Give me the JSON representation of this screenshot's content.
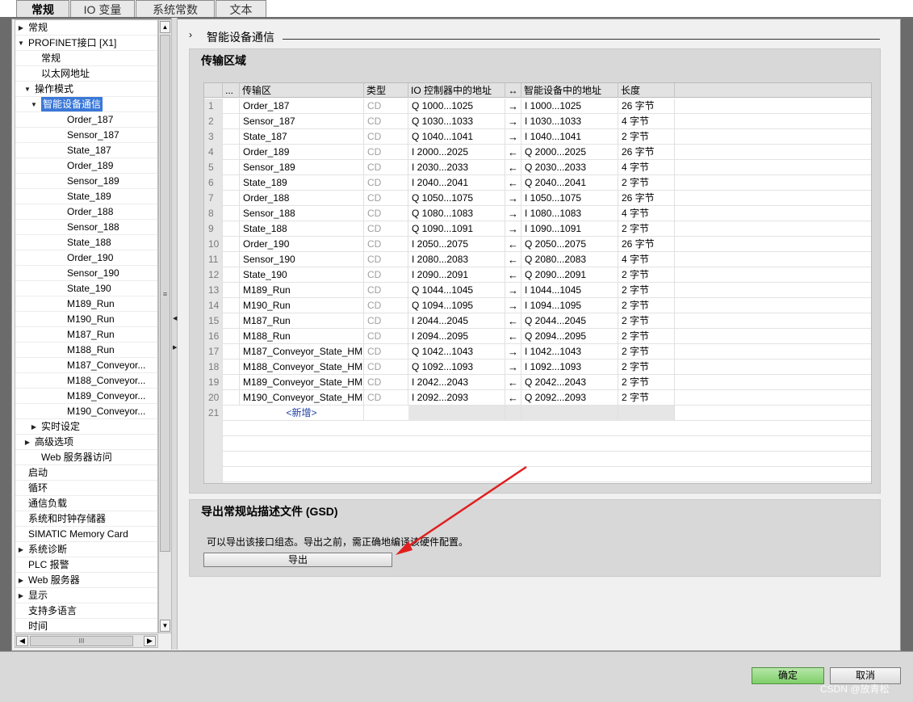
{
  "tabs": [
    "常规",
    "IO 变量",
    "系统常数",
    "文本"
  ],
  "tree": [
    {
      "label": "常规",
      "indent": 0,
      "arrow": "right"
    },
    {
      "label": "PROFINET接口 [X1]",
      "indent": 0,
      "arrow": "down"
    },
    {
      "label": "常规",
      "indent": 2,
      "arrow": ""
    },
    {
      "label": "以太网地址",
      "indent": 2,
      "arrow": ""
    },
    {
      "label": "操作模式",
      "indent": 1,
      "arrow": "down"
    },
    {
      "label": "智能设备通信",
      "indent": 2,
      "arrow": "down",
      "selected": true
    },
    {
      "label": "Order_187",
      "indent": 4,
      "arrow": ""
    },
    {
      "label": "Sensor_187",
      "indent": 4,
      "arrow": ""
    },
    {
      "label": "State_187",
      "indent": 4,
      "arrow": ""
    },
    {
      "label": "Order_189",
      "indent": 4,
      "arrow": ""
    },
    {
      "label": "Sensor_189",
      "indent": 4,
      "arrow": ""
    },
    {
      "label": "State_189",
      "indent": 4,
      "arrow": ""
    },
    {
      "label": "Order_188",
      "indent": 4,
      "arrow": ""
    },
    {
      "label": "Sensor_188",
      "indent": 4,
      "arrow": ""
    },
    {
      "label": "State_188",
      "indent": 4,
      "arrow": ""
    },
    {
      "label": "Order_190",
      "indent": 4,
      "arrow": ""
    },
    {
      "label": "Sensor_190",
      "indent": 4,
      "arrow": ""
    },
    {
      "label": "State_190",
      "indent": 4,
      "arrow": ""
    },
    {
      "label": "M189_Run",
      "indent": 4,
      "arrow": ""
    },
    {
      "label": "M190_Run",
      "indent": 4,
      "arrow": ""
    },
    {
      "label": "M187_Run",
      "indent": 4,
      "arrow": ""
    },
    {
      "label": "M188_Run",
      "indent": 4,
      "arrow": ""
    },
    {
      "label": "M187_Conveyor...",
      "indent": 4,
      "arrow": ""
    },
    {
      "label": "M188_Conveyor...",
      "indent": 4,
      "arrow": ""
    },
    {
      "label": "M189_Conveyor...",
      "indent": 4,
      "arrow": ""
    },
    {
      "label": "M190_Conveyor...",
      "indent": 4,
      "arrow": ""
    },
    {
      "label": "实时设定",
      "indent": 2,
      "arrow": "right"
    },
    {
      "label": "高级选项",
      "indent": 1,
      "arrow": "right"
    },
    {
      "label": "Web 服务器访问",
      "indent": 2,
      "arrow": ""
    },
    {
      "label": "启动",
      "indent": 0,
      "arrow": ""
    },
    {
      "label": "循环",
      "indent": 0,
      "arrow": ""
    },
    {
      "label": "通信负载",
      "indent": 0,
      "arrow": ""
    },
    {
      "label": "系统和时钟存储器",
      "indent": 0,
      "arrow": ""
    },
    {
      "label": "SIMATIC Memory Card",
      "indent": 0,
      "arrow": ""
    },
    {
      "label": "系统诊断",
      "indent": 0,
      "arrow": "right"
    },
    {
      "label": "PLC 报警",
      "indent": 0,
      "arrow": ""
    },
    {
      "label": "Web 服务器",
      "indent": 0,
      "arrow": "right"
    },
    {
      "label": "显示",
      "indent": 0,
      "arrow": "right"
    },
    {
      "label": "支持多语言",
      "indent": 0,
      "arrow": ""
    },
    {
      "label": "时间",
      "indent": 0,
      "arrow": ""
    }
  ],
  "section_title": "智能设备通信",
  "transfer_panel_title": "传输区域",
  "table_headers": [
    "...",
    "传输区",
    "类型",
    "IO 控制器中的地址",
    "↔",
    "智能设备中的地址",
    "长度"
  ],
  "table_rows": [
    {
      "num": "1",
      "name": "Order_187",
      "type": "CD",
      "io": "Q 1000...1025",
      "dir": "→",
      "dev": "I 1000...1025",
      "len": "26 字节"
    },
    {
      "num": "2",
      "name": "Sensor_187",
      "type": "CD",
      "io": "Q 1030...1033",
      "dir": "→",
      "dev": "I 1030...1033",
      "len": "4 字节"
    },
    {
      "num": "3",
      "name": "State_187",
      "type": "CD",
      "io": "Q 1040...1041",
      "dir": "→",
      "dev": "I 1040...1041",
      "len": "2 字节"
    },
    {
      "num": "4",
      "name": "Order_189",
      "type": "CD",
      "io": "I 2000...2025",
      "dir": "←",
      "dev": "Q 2000...2025",
      "len": "26 字节"
    },
    {
      "num": "5",
      "name": "Sensor_189",
      "type": "CD",
      "io": "I 2030...2033",
      "dir": "←",
      "dev": "Q 2030...2033",
      "len": "4 字节"
    },
    {
      "num": "6",
      "name": "State_189",
      "type": "CD",
      "io": "I 2040...2041",
      "dir": "←",
      "dev": "Q 2040...2041",
      "len": "2 字节"
    },
    {
      "num": "7",
      "name": "Order_188",
      "type": "CD",
      "io": "Q 1050...1075",
      "dir": "→",
      "dev": "I 1050...1075",
      "len": "26 字节"
    },
    {
      "num": "8",
      "name": "Sensor_188",
      "type": "CD",
      "io": "Q 1080...1083",
      "dir": "→",
      "dev": "I 1080...1083",
      "len": "4 字节"
    },
    {
      "num": "9",
      "name": "State_188",
      "type": "CD",
      "io": "Q 1090...1091",
      "dir": "→",
      "dev": "I 1090...1091",
      "len": "2 字节"
    },
    {
      "num": "10",
      "name": "Order_190",
      "type": "CD",
      "io": "I 2050...2075",
      "dir": "←",
      "dev": "Q 2050...2075",
      "len": "26 字节"
    },
    {
      "num": "11",
      "name": "Sensor_190",
      "type": "CD",
      "io": "I 2080...2083",
      "dir": "←",
      "dev": "Q 2080...2083",
      "len": "4 字节"
    },
    {
      "num": "12",
      "name": "State_190",
      "type": "CD",
      "io": "I 2090...2091",
      "dir": "←",
      "dev": "Q 2090...2091",
      "len": "2 字节"
    },
    {
      "num": "13",
      "name": "M189_Run",
      "type": "CD",
      "io": "Q 1044...1045",
      "dir": "→",
      "dev": "I 1044...1045",
      "len": "2 字节"
    },
    {
      "num": "14",
      "name": "M190_Run",
      "type": "CD",
      "io": "Q 1094...1095",
      "dir": "→",
      "dev": "I 1094...1095",
      "len": "2 字节"
    },
    {
      "num": "15",
      "name": "M187_Run",
      "type": "CD",
      "io": "I 2044...2045",
      "dir": "←",
      "dev": "Q 2044...2045",
      "len": "2 字节"
    },
    {
      "num": "16",
      "name": "M188_Run",
      "type": "CD",
      "io": "I 2094...2095",
      "dir": "←",
      "dev": "Q 2094...2095",
      "len": "2 字节"
    },
    {
      "num": "17",
      "name": "M187_Conveyor_State_HMI",
      "type": "CD",
      "io": "Q 1042...1043",
      "dir": "→",
      "dev": "I 1042...1043",
      "len": "2 字节"
    },
    {
      "num": "18",
      "name": "M188_Conveyor_State_HMI",
      "type": "CD",
      "io": "Q 1092...1093",
      "dir": "→",
      "dev": "I 1092...1093",
      "len": "2 字节"
    },
    {
      "num": "19",
      "name": "M189_Conveyor_State_HMI",
      "type": "CD",
      "io": "I 2042...2043",
      "dir": "←",
      "dev": "Q 2042...2043",
      "len": "2 字节"
    },
    {
      "num": "20",
      "name": "M190_Conveyor_State_HMI",
      "type": "CD",
      "io": "I 2092...2093",
      "dir": "←",
      "dev": "Q 2092...2093",
      "len": "2 字节"
    }
  ],
  "new_row": {
    "num": "21",
    "label": "<新增>"
  },
  "gsd_panel_title": "导出常规站描述文件 (GSD)",
  "gsd_description": "可以导出该接口组态。导出之前，需正确地编译该硬件配置。",
  "export_button": "导出",
  "ok_button": "确定",
  "cancel_button": "取消",
  "watermark": "CSDN @放青松",
  "colors": {
    "selection": "#3a78d8",
    "ok_green": "#7fcf6a",
    "annotation_arrow": "#e02020"
  }
}
